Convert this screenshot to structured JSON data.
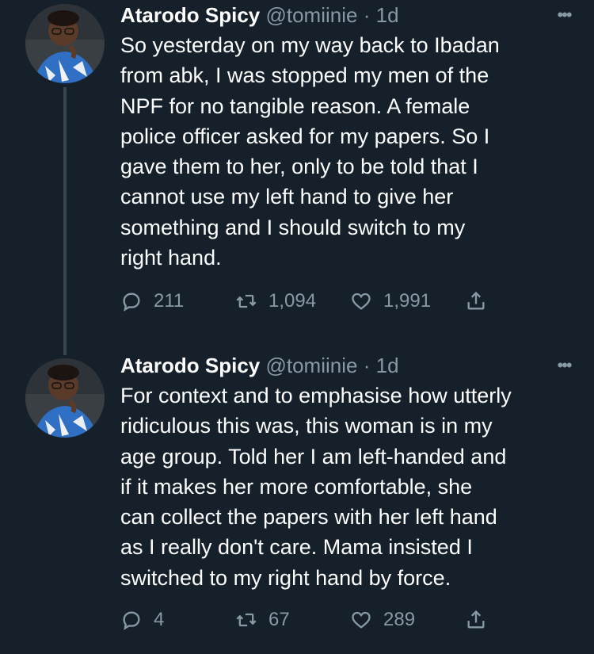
{
  "tweets": [
    {
      "author": "Atarodo Spicy",
      "handle": "@tomiinie",
      "separator": "·",
      "time": "1d",
      "more_icon": "more-horizontal-icon",
      "text": "So yesterday on my way back to Ibadan\nfrom abk, I was stopped my men of the\nNPF for no tangible reason. A female\npolice officer asked for my papers. So I\ngave them to her, only to be told that I\ncannot use my left hand to give her\nsomething and I should switch to my\nright hand.",
      "replies": "211",
      "retweets": "1,094",
      "likes": "1,991"
    },
    {
      "author": "Atarodo Spicy",
      "handle": "@tomiinie",
      "separator": "·",
      "time": "1d",
      "more_icon": "more-horizontal-icon",
      "text": "For context and to emphasise how utterly\nridiculous this was, this woman is in my\nage group. Told her I  am left-handed and\nif it makes her more comfortable, she\ncan collect the papers with her left hand\nas I really don't care. Mama insisted I\nswitched to my right hand by force.",
      "replies": "4",
      "retweets": "67",
      "likes": "289"
    }
  ],
  "colors": {
    "background": "#15202b",
    "text": "#ffffff",
    "secondary": "#8899a6",
    "thread_line": "#38444d"
  }
}
